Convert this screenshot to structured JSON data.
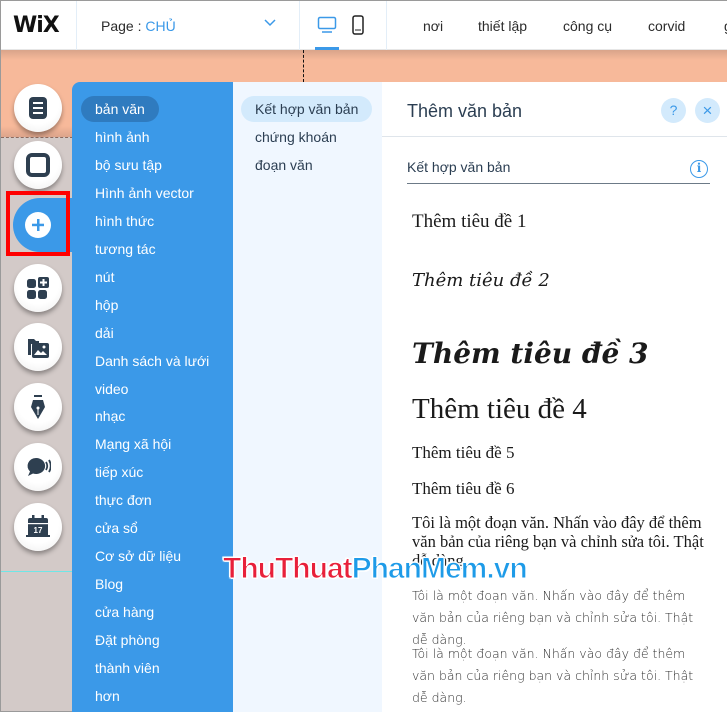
{
  "topbar": {
    "logo": "WiX",
    "page_label": "Page : ",
    "page_name": "CHỦ",
    "nav": [
      "nơi",
      "thiết lập",
      "công cụ",
      "corvid",
      "g"
    ]
  },
  "rail": {
    "buttons": [
      {
        "name": "menus-pages",
        "icon": "page-icon"
      },
      {
        "name": "background",
        "icon": "square-icon"
      },
      {
        "name": "add",
        "icon": "plus-icon",
        "active": true
      },
      {
        "name": "add-apps",
        "icon": "apps-plus-icon"
      },
      {
        "name": "media",
        "icon": "media-folder-icon"
      },
      {
        "name": "design",
        "icon": "pen-nib-icon"
      },
      {
        "name": "chat",
        "icon": "chat-bubble-icon"
      },
      {
        "name": "bookings",
        "icon": "calendar-icon",
        "calendar_day": "17"
      }
    ]
  },
  "categories": {
    "active_index": 0,
    "items": [
      "bản văn",
      "hình ảnh",
      "bộ sưu tập",
      "Hình ảnh vector",
      "hình thức",
      "tương tác",
      "nút",
      "hộp",
      "dải",
      "Danh sách và lưới",
      "video",
      "nhạc",
      "Mạng xã hội",
      "tiếp xúc",
      "thực đơn",
      "cửa sổ",
      "Cơ sở dữ liệu",
      "Blog",
      "cửa hàng",
      "Đặt phòng",
      "thành viên",
      "hơn"
    ]
  },
  "subcategories": {
    "active_index": 0,
    "items": [
      "Kết hợp văn bản",
      "chứng khoán",
      "đoạn văn"
    ]
  },
  "panel": {
    "title": "Thêm văn bản",
    "help_label": "?",
    "close_label": "×",
    "section_title": "Kết hợp văn bản",
    "info_label": "i",
    "presets": {
      "h1": "Thêm tiêu đề 1",
      "h2": "Thêm tiêu đề 2",
      "h3": "Thêm tiêu đề 3",
      "h4": "Thêm tiêu đề 4",
      "h5": "Thêm tiêu đề 5",
      "h6": "Thêm tiêu đề 6",
      "p1": "Tôi là một đoạn văn. Nhấn vào đây để thêm văn bản của riêng bạn và chỉnh sửa tôi. Thật dễ dàng.",
      "p2": "Tôi là một đoạn văn. Nhấn vào đây để thêm văn bản của riêng bạn và chỉnh sửa tôi. Thật dễ dàng.",
      "p3": "Tôi là một đoạn văn. Nhấn vào đây để thêm văn bản của riêng bạn và chỉnh sửa tôi. Thật dễ dàng."
    }
  },
  "watermark": {
    "part1": "ThuThuat",
    "part2": "PhanMem.vn"
  },
  "colors": {
    "accent": "#3b99e8",
    "highlight": "#ff0000",
    "header_strip": "#f7b99a"
  }
}
